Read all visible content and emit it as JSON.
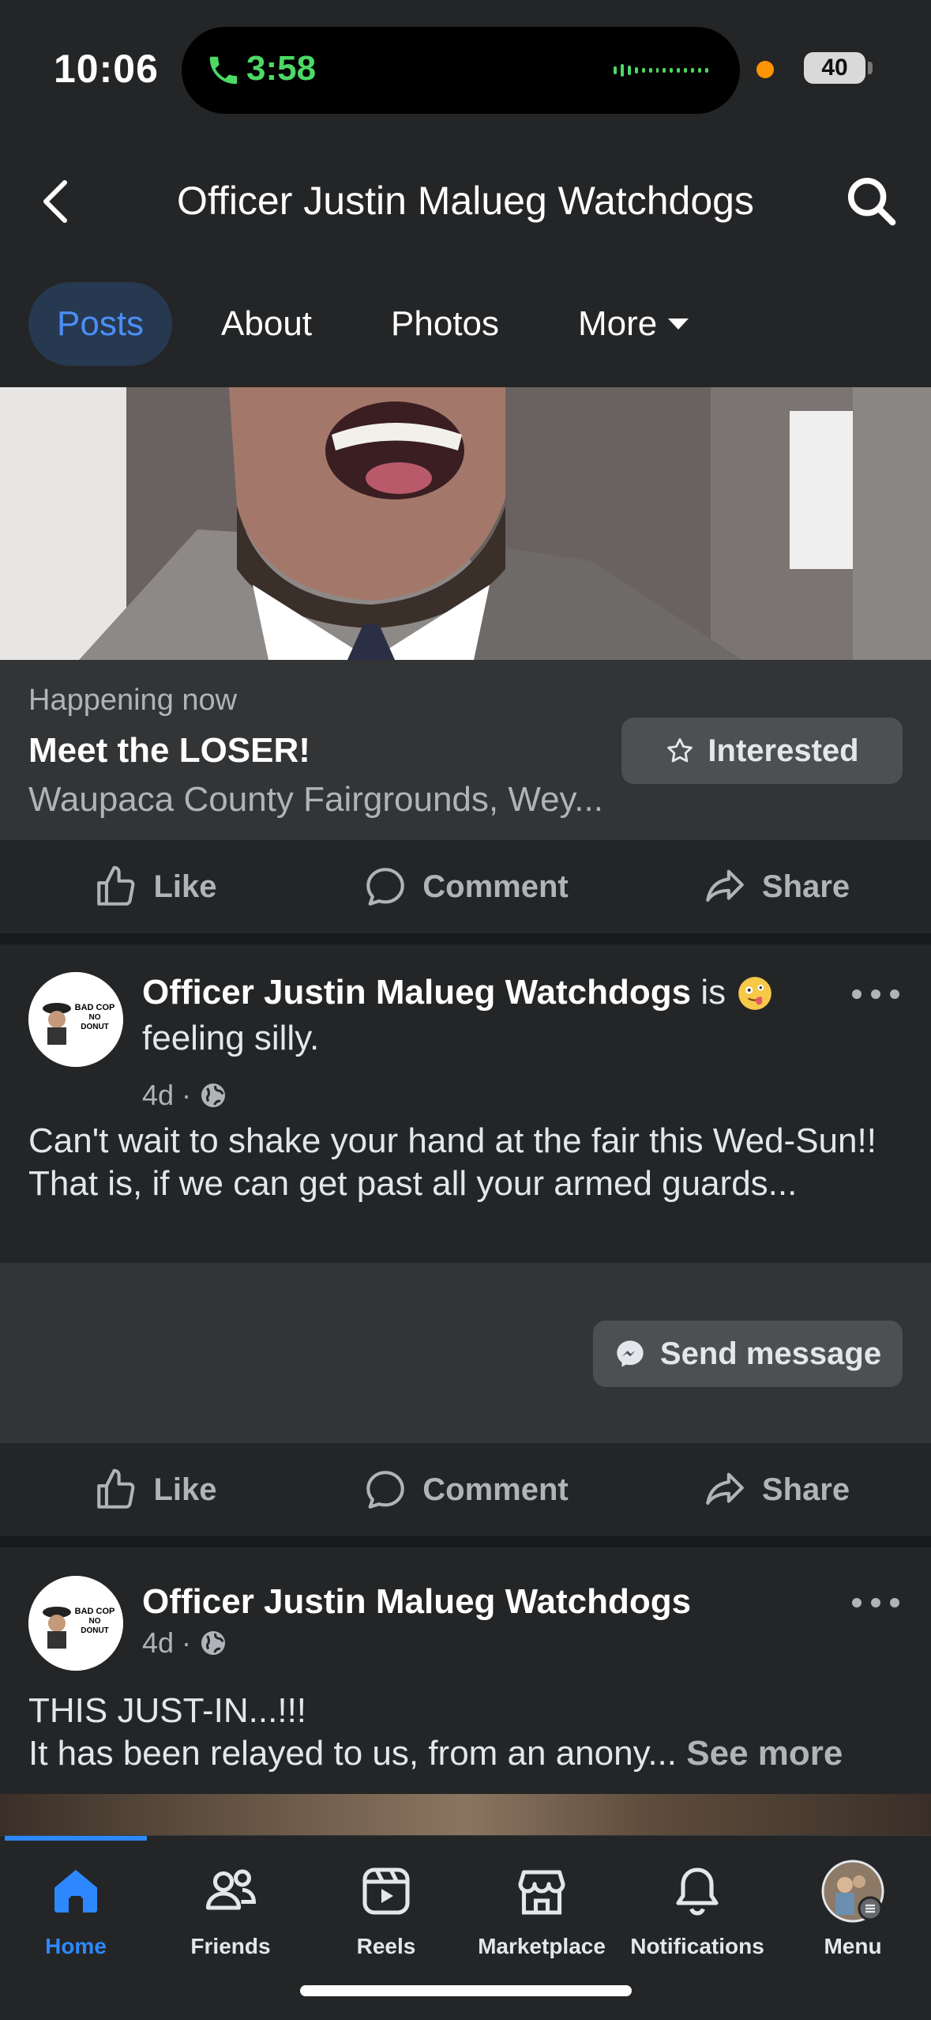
{
  "status_bar": {
    "time": "10:06",
    "call_timer": "3:58",
    "battery": "40"
  },
  "header": {
    "title": "Officer Justin Malueg Watchdogs"
  },
  "tabs": [
    {
      "label": "Posts",
      "active": true
    },
    {
      "label": "About",
      "active": false
    },
    {
      "label": "Photos",
      "active": false
    },
    {
      "label": "More",
      "active": false
    }
  ],
  "event": {
    "status": "Happening now",
    "title": "Meet the LOSER!",
    "location": "Waupaca County Fairgrounds, Wey...",
    "interested_label": "Interested"
  },
  "actions": {
    "like": "Like",
    "comment": "Comment",
    "share": "Share"
  },
  "posts": [
    {
      "author": "Officer Justin Malueg Watchdogs",
      "feeling_prefix": "is",
      "feeling": "feeling silly.",
      "age": "4d",
      "text_line1": "Can't wait to shake your hand at the fair this Wed-Sun!!",
      "text_line2": "That is, if we can get past all your armed guards...",
      "send_message_label": "Send message"
    },
    {
      "author": "Officer Justin Malueg Watchdogs",
      "age": "4d",
      "text_line1": "THIS JUST-IN...!!!",
      "text_line2": "It has been relayed to us, from an anony...",
      "see_more": "See more"
    }
  ],
  "avatar_logo_text": "BAD COP NO DONUT",
  "bottom_nav": [
    {
      "label": "Home",
      "icon": "home-icon",
      "active": true
    },
    {
      "label": "Friends",
      "icon": "friends-icon",
      "active": false
    },
    {
      "label": "Reels",
      "icon": "reels-icon",
      "active": false
    },
    {
      "label": "Marketplace",
      "icon": "marketplace-icon",
      "active": false
    },
    {
      "label": "Notifications",
      "icon": "bell-icon",
      "active": false
    },
    {
      "label": "Menu",
      "icon": "profile-avatar",
      "active": false
    }
  ],
  "colors": {
    "background": "#242526",
    "accent": "#2d88ff",
    "active_tab_bg": "#263951",
    "call_green": "#4cd964"
  }
}
